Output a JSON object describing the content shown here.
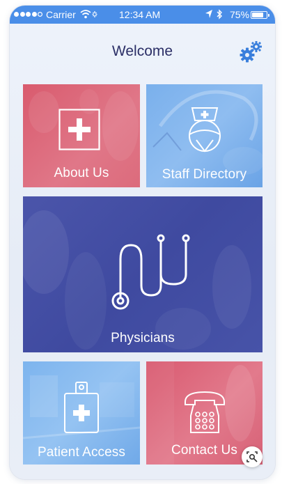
{
  "status_bar": {
    "carrier": "Carrier",
    "time": "12:34 AM",
    "battery": "75%"
  },
  "header": {
    "title": "Welcome",
    "settings_icon": "gears-icon"
  },
  "tiles": {
    "about": {
      "label": "About Us",
      "icon": "medical-cross-icon",
      "color": "#d95b6e"
    },
    "staff": {
      "label": "Staff Directory",
      "icon": "nurse-icon",
      "color": "#7ab0ec"
    },
    "physicians": {
      "label": "Physicians",
      "icon": "stethoscope-icon",
      "color": "#4b55aa"
    },
    "patient": {
      "label": "Patient Access",
      "icon": "patient-id-badge-icon",
      "color": "#7db4ee"
    },
    "contact": {
      "label": "Contact Us",
      "icon": "telephone-icon",
      "color": "#d95a70"
    }
  },
  "colors": {
    "status_bar": "#4a8ee8",
    "title": "#2b2f66",
    "gear": "#3a7fdc"
  }
}
